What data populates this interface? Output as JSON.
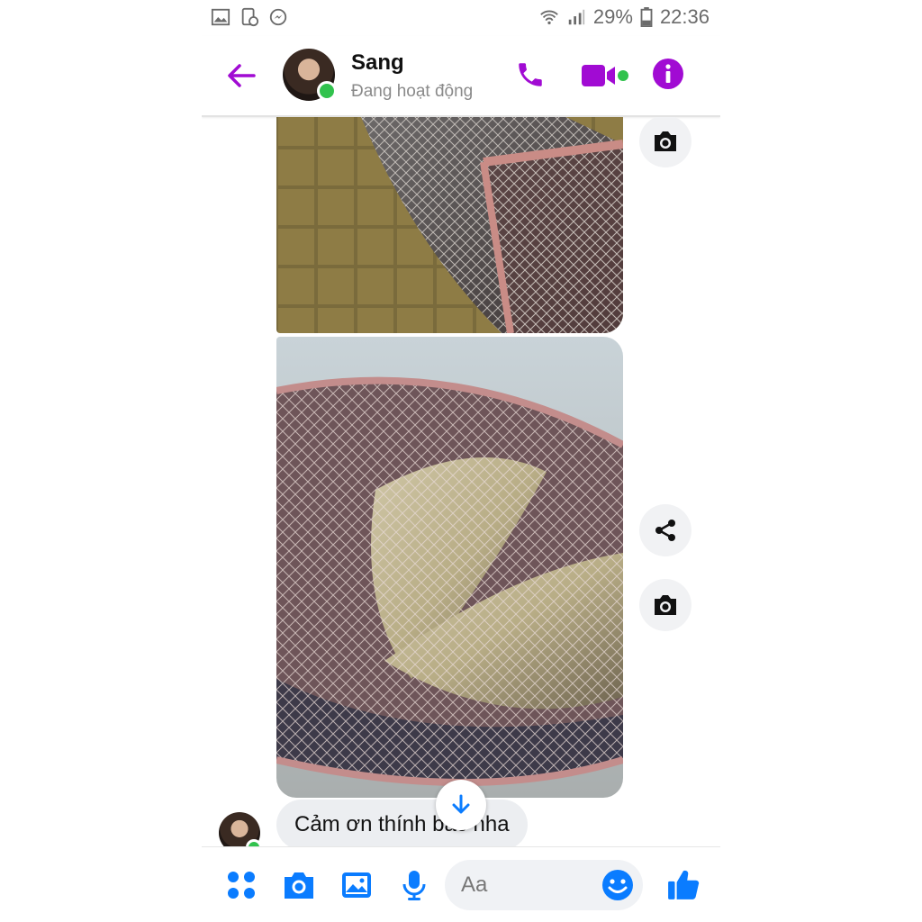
{
  "status_bar": {
    "battery_percent": "29%",
    "time": "22:36",
    "left_icons": [
      "gallery-icon",
      "screenshot-icon",
      "messenger-icon"
    ],
    "right_icons": [
      "wifi-icon",
      "signal-icon",
      "battery-icon"
    ]
  },
  "header": {
    "contact_name": "Sang",
    "presence": "Đang hoạt động",
    "icons": [
      "back-arrow-icon",
      "phone-icon",
      "video-icon",
      "info-icon"
    ]
  },
  "conversation": {
    "photos": [
      "photo",
      "photo"
    ],
    "side_actions": [
      "camera-icon",
      "share-icon",
      "camera-icon"
    ],
    "last_message": "Cảm ơn thính bác nha"
  },
  "composer": {
    "placeholder": "Aa",
    "icons": [
      "menu-dots-icon",
      "camera-icon",
      "image-icon",
      "microphone-icon",
      "emoji-icon",
      "thumbs-up-icon"
    ]
  },
  "colors": {
    "accent_purple": "#a10bd3",
    "accent_blue": "#0a7cff",
    "online_green": "#31c24d",
    "bubble_gray": "#eceef1"
  }
}
